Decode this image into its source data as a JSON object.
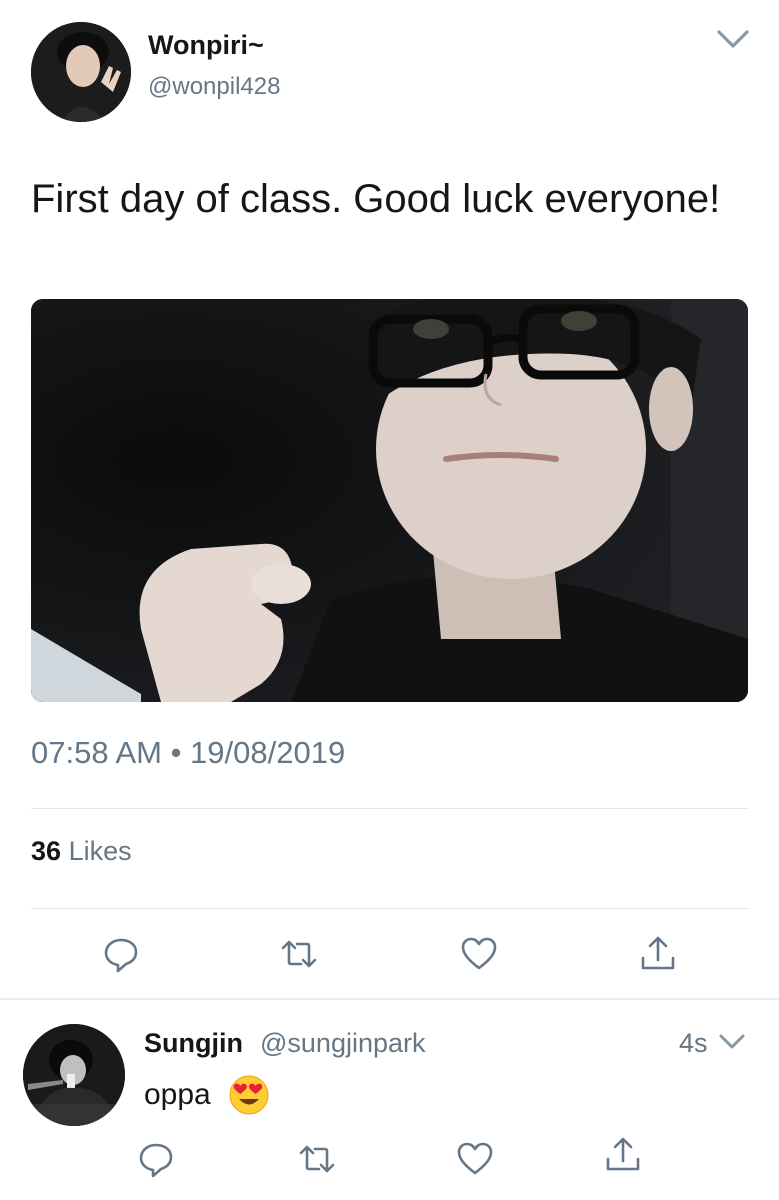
{
  "tweet": {
    "display_name": "Wonpiri~",
    "handle": "@wonpil428",
    "text": "First day of class. Good luck everyone!",
    "timestamp": "07:58 AM • 19/08/2019",
    "likes_count": "36",
    "likes_label": "Likes",
    "actions": [
      "reply-icon",
      "retweet-icon",
      "like-icon",
      "share-icon"
    ]
  },
  "reply": {
    "display_name": "Sungjin",
    "handle": "@sungjinpark",
    "time": "4s",
    "text": "oppa",
    "emoji": "heart-eyes-emoji",
    "actions": [
      "reply-icon",
      "retweet-icon",
      "like-icon",
      "share-icon"
    ]
  },
  "colors": {
    "text_primary": "#14171a",
    "text_secondary": "#657786",
    "divider": "#e1e8ed",
    "icon": "#657786"
  }
}
